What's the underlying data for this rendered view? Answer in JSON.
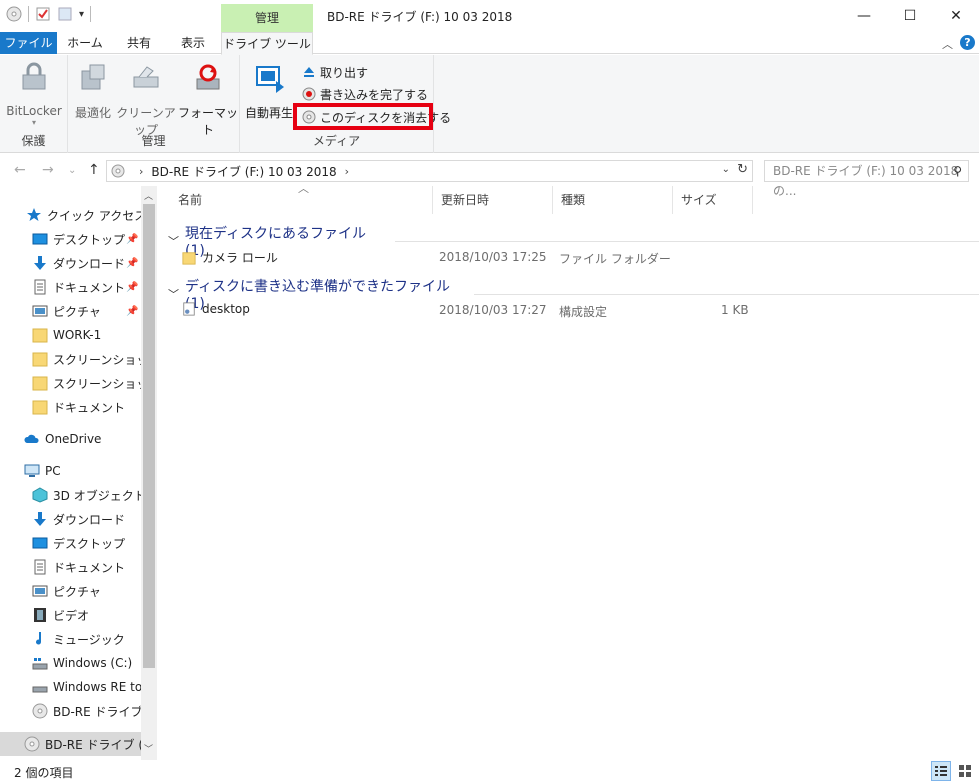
{
  "window": {
    "title": "BD-RE ドライブ (F:) 10 03 2018",
    "contextual_header": "管理",
    "minimize": "—",
    "maximize": "☐",
    "close": "✕"
  },
  "tabs": [
    "ファイル",
    "ホーム",
    "共有",
    "表示",
    "ドライブ ツール"
  ],
  "ribbon": {
    "protect": {
      "bitlocker": "BitLocker",
      "label": "保護"
    },
    "manage": {
      "optimize": "最適化",
      "cleanup": "クリーンアップ",
      "format": "フォーマット",
      "label": "管理"
    },
    "media": {
      "autoplay": "自動再生",
      "eject": "取り出す",
      "finish_burning": "書き込みを完了する",
      "erase_disc": "このディスクを消去する",
      "label": "メディア"
    }
  },
  "address": {
    "path": [
      "BD-RE ドライブ (F:) 10 03 2018"
    ],
    "search_placeholder": "BD-RE ドライブ (F:) 10 03 2018の..."
  },
  "nav": {
    "items": [
      {
        "label": "クイック アクセス",
        "icon": "star-icon"
      },
      {
        "label": "デスクトップ",
        "icon": "desktop-icon",
        "pinned": true
      },
      {
        "label": "ダウンロード",
        "icon": "download-icon",
        "pinned": true
      },
      {
        "label": "ドキュメント",
        "icon": "document-icon",
        "pinned": true
      },
      {
        "label": "ピクチャ",
        "icon": "picture-icon",
        "pinned": true
      },
      {
        "label": "WORK-1",
        "icon": "folder-icon"
      },
      {
        "label": "スクリーンショット",
        "icon": "folder-icon"
      },
      {
        "label": "スクリーンショット",
        "icon": "folder-icon"
      },
      {
        "label": "ドキュメント",
        "icon": "folder-icon"
      },
      {
        "label": "OneDrive",
        "icon": "cloud-icon"
      },
      {
        "label": "PC",
        "icon": "pc-icon"
      },
      {
        "label": "3D オブジェクト",
        "icon": "cube-icon"
      },
      {
        "label": "ダウンロード",
        "icon": "download-icon"
      },
      {
        "label": "デスクトップ",
        "icon": "desktop-icon"
      },
      {
        "label": "ドキュメント",
        "icon": "document-icon"
      },
      {
        "label": "ピクチャ",
        "icon": "picture-icon"
      },
      {
        "label": "ビデオ",
        "icon": "video-icon"
      },
      {
        "label": "ミュージック",
        "icon": "music-icon"
      },
      {
        "label": "Windows (C:)",
        "icon": "drive-icon"
      },
      {
        "label": "Windows RE tools",
        "icon": "drive-icon"
      },
      {
        "label": "BD-RE ドライブ (F:",
        "icon": "disc-icon"
      },
      {
        "label": "BD-RE ドライブ (F:)",
        "icon": "disc-icon",
        "selected": true
      }
    ]
  },
  "columns": {
    "name": "名前",
    "modified": "更新日時",
    "type": "種類",
    "size": "サイズ"
  },
  "groups": [
    {
      "title": "現在ディスクにあるファイル (1)",
      "files": [
        {
          "name": "カメラ ロール",
          "modified": "2018/10/03 17:25",
          "type": "ファイル フォルダー",
          "size": "",
          "icon": "folder-icon"
        }
      ]
    },
    {
      "title": "ディスクに書き込む準備ができたファイル (1)",
      "files": [
        {
          "name": "desktop",
          "modified": "2018/10/03 17:27",
          "type": "構成設定",
          "size": "1 KB",
          "icon": "settings-file-icon"
        }
      ]
    }
  ],
  "status": {
    "count": "2 個の項目"
  },
  "colors": {
    "accent": "#1979ca",
    "context_tab": "#c9f0b3",
    "highlight": "#e60012",
    "group_header": "#1e3287"
  }
}
